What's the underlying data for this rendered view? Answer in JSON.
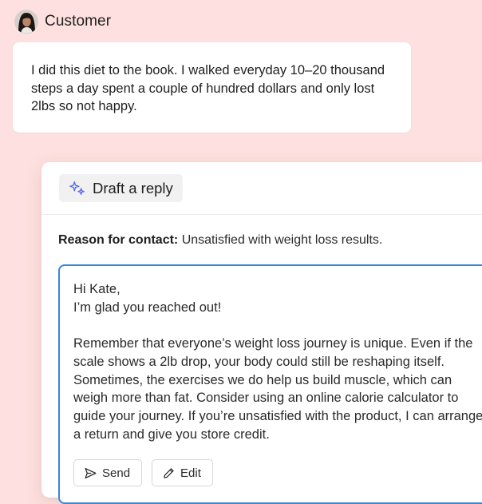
{
  "customer": {
    "name": "Customer",
    "avatar_icon": "customer-avatar",
    "message": "I did this diet to the book. I walked everyday 10–20 thousand steps a day spent a couple of hundred dollars and only lost 2lbs so not happy."
  },
  "draft": {
    "chip_label": "Draft a reply",
    "chip_icon": "sparkle-icon"
  },
  "reason": {
    "label": "Reason for contact:",
    "value": "Unsatisfied with weight loss results."
  },
  "reply": {
    "greeting": "Hi Kate,",
    "opener": "I’m glad you reached out!",
    "body": "Remember that everyone’s weight loss journey is unique. Even if the scale shows a 2lb drop, your body could still be reshaping itself. Sometimes, the exercises we do help us build muscle, which can weigh more than fat. Consider using an online calorie calculator to guide your journey. If you’re unsatisfied with the product, I can arrange a return and give you store credit."
  },
  "actions": {
    "send_label": "Send",
    "send_icon": "send-icon",
    "edit_label": "Edit",
    "edit_icon": "pencil-icon"
  },
  "colors": {
    "background": "#fde0df",
    "accent_border": "#3a86d9",
    "sparkle": "#5b6ee8"
  }
}
